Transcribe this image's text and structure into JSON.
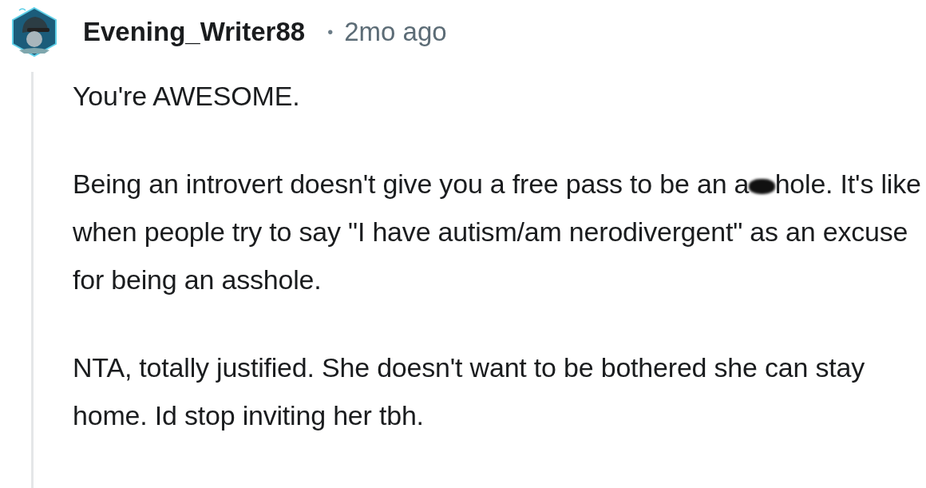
{
  "comment": {
    "username": "Evening_Writer88",
    "separator": "•",
    "time": "2mo ago",
    "paragraphs": [
      {
        "parts": [
          {
            "kind": "text",
            "text": "You're AWESOME."
          }
        ]
      },
      {
        "parts": [
          {
            "kind": "text",
            "text": "Being an introvert doesn't give you a free pass to be an a"
          },
          {
            "kind": "censor"
          },
          {
            "kind": "text",
            "text": "hole. It's like when people try to say \"I have autism/am nerodivergent\" as an excuse for being an asshole."
          }
        ]
      },
      {
        "parts": [
          {
            "kind": "text",
            "text": "NTA, totally justified. She doesn't want to be bothered she can stay home. Id stop inviting her tbh."
          }
        ]
      }
    ]
  }
}
